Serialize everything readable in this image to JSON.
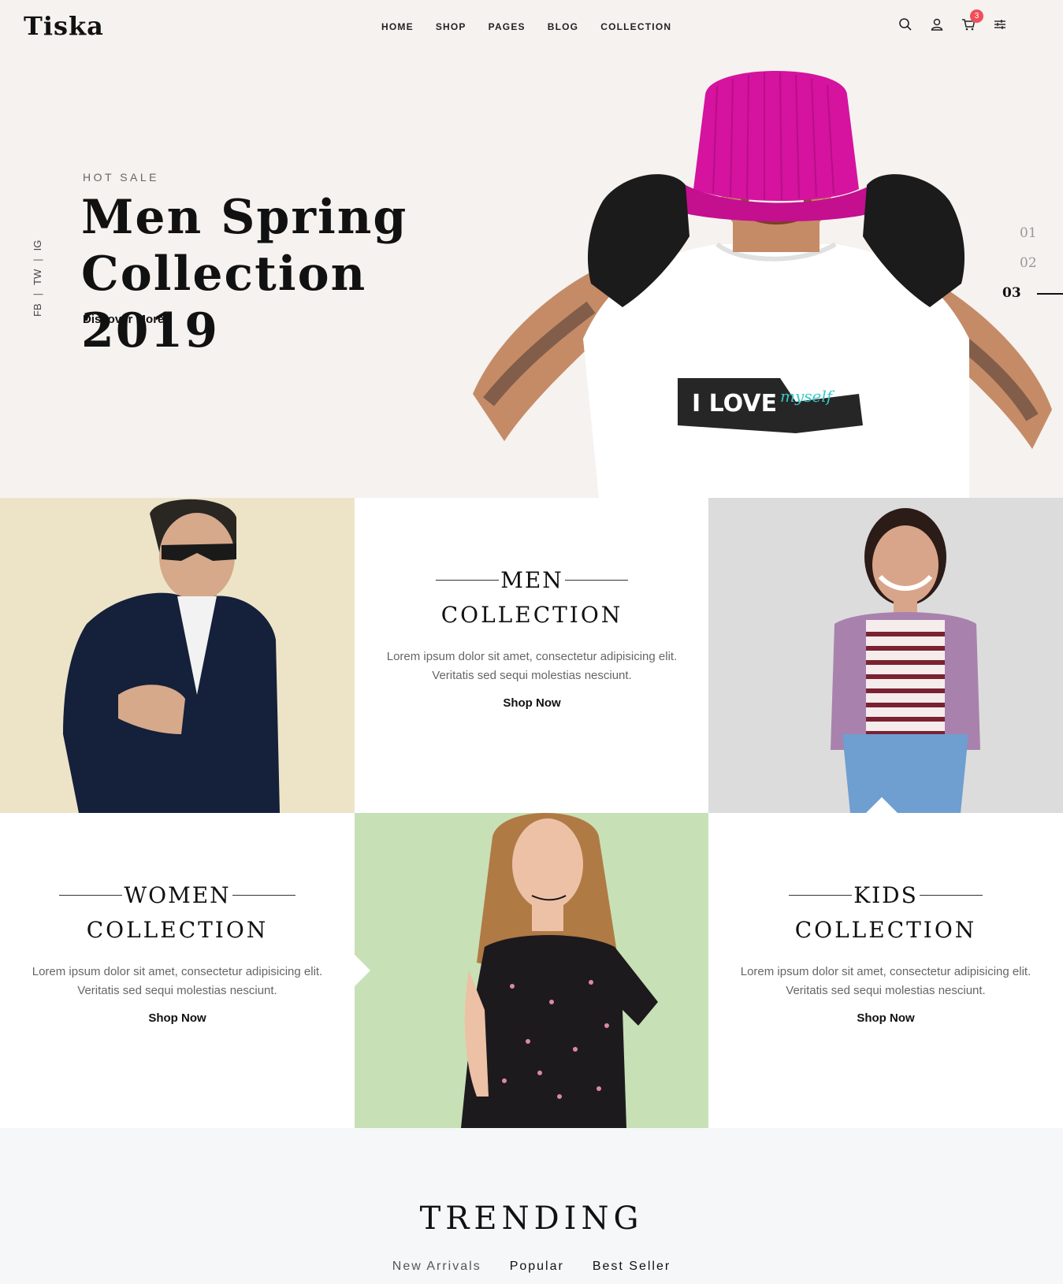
{
  "header": {
    "logo": "Tiska",
    "nav": [
      "HOME",
      "SHOP",
      "PAGES",
      "BLOG",
      "COLLECTION"
    ],
    "cart_count": "3",
    "icons": [
      "search-icon",
      "user-icon",
      "cart-icon",
      "sliders-icon"
    ]
  },
  "hero": {
    "social": [
      "FB",
      "TW",
      "IG"
    ],
    "kicker": "HOT SALE",
    "title_line1": "Men Spring",
    "title_line2": "Collection 2019",
    "cta": "Discover More",
    "slides": [
      "01",
      "02",
      "03"
    ],
    "shirt_text": "I LOVE",
    "shirt_script": "myself"
  },
  "collections": {
    "men": {
      "title1": "MEN",
      "title2": "COLLECTION",
      "desc": "Lorem ipsum dolor sit amet, consectetur adipisicing elit. Veritatis sed sequi molestias nesciunt.",
      "cta": "Shop Now"
    },
    "women": {
      "title1": "WOMEN",
      "title2": "COLLECTION",
      "desc": "Lorem ipsum dolor sit amet, consectetur adipisicing elit. Veritatis sed sequi molestias nesciunt.",
      "cta": "Shop Now"
    },
    "kids": {
      "title1": "KIDS",
      "title2": "COLLECTION",
      "desc": "Lorem ipsum dolor sit amet, consectetur adipisicing elit. Veritatis sed sequi molestias nesciunt.",
      "cta": "Shop Now"
    }
  },
  "trending": {
    "title": "TRENDING",
    "tabs": [
      "New Arrivals",
      "Popular",
      "Best Seller"
    ]
  },
  "colors": {
    "hero_bg": "#f5f2ef",
    "men_bg": "#ede4c8",
    "kid_bg": "#dcdcdc",
    "woman_bg": "#c8e0b6",
    "badge": "#ef4f5a",
    "hat": "#d5139e"
  }
}
